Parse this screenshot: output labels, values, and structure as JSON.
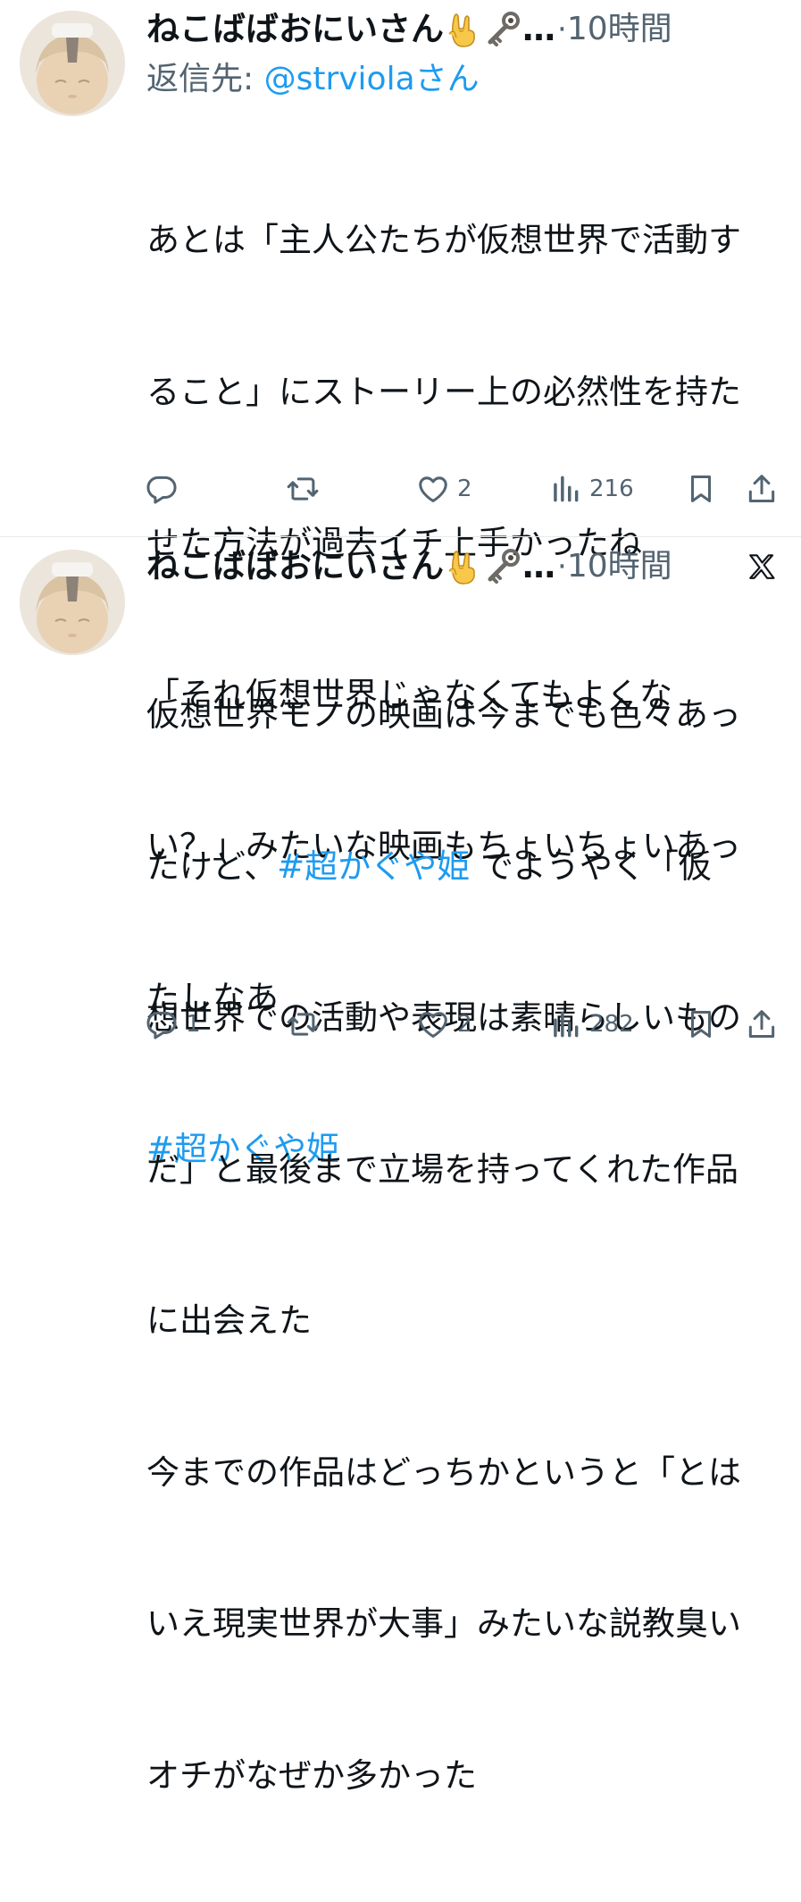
{
  "tweets": [
    {
      "author_name": "ねこばばおにいさん",
      "author_emojis": [
        "sign-of-the-horns-emoji",
        "old-key-emoji"
      ],
      "ellipsis": "…",
      "separator": "·",
      "time": "10時間",
      "reply_label": "返信先: ",
      "reply_handle": "@strviola",
      "reply_suffix": "さん",
      "lines": [
        {
          "pre": "あとは「主人公たちが仮想世界で活動す",
          "tag": "",
          "post": ""
        },
        {
          "pre": "ること」にストーリー上の必然性を持た",
          "tag": "",
          "post": ""
        },
        {
          "pre": "せた方法が過去イチ上手かったね",
          "tag": "",
          "post": ""
        },
        {
          "pre": "「それ仮想世界じゃなくてもよくな",
          "tag": "",
          "post": ""
        },
        {
          "pre": "い？」みたいな映画もちょいちょいあっ",
          "tag": "",
          "post": ""
        },
        {
          "pre": "たしなあ",
          "tag": "",
          "post": ""
        },
        {
          "pre": "",
          "tag": "#超かぐや姫",
          "post": ""
        }
      ],
      "actions": {
        "reply": "",
        "retweet": "",
        "like": "2",
        "views": "216"
      },
      "icons": [
        "reply-icon",
        "retweet-icon",
        "like-icon",
        "views-icon",
        "bookmark-icon",
        "share-icon"
      ]
    },
    {
      "author_name": "ねこばばおにいさん",
      "author_emojis": [
        "sign-of-the-horns-emoji",
        "old-key-emoji"
      ],
      "ellipsis": "…",
      "separator": "·",
      "time": "10時間",
      "platform_icon": "x-logo-icon",
      "lines": [
        {
          "pre": "仮想世界モノの映画は今までも色々あっ",
          "tag": "",
          "post": ""
        },
        {
          "pre": "たけど、",
          "tag": "#超かぐや姫",
          "post": "でようやく「仮"
        },
        {
          "pre": "想世界での活動や表現は素晴らしいもの",
          "tag": "",
          "post": ""
        },
        {
          "pre": "だ」と最後まで立場を持ってくれた作品",
          "tag": "",
          "post": ""
        },
        {
          "pre": "に出会えた",
          "tag": "",
          "post": ""
        },
        {
          "pre": "今までの作品はどっちかというと「とは",
          "tag": "",
          "post": ""
        },
        {
          "pre": "いえ現実世界が大事」みたいな説教臭い",
          "tag": "",
          "post": ""
        },
        {
          "pre": "オチがなぜか多かった",
          "tag": "",
          "post": ""
        }
      ],
      "actions": {
        "reply": "1",
        "retweet": "",
        "like": "2",
        "views": "282"
      },
      "icons": [
        "reply-icon",
        "retweet-icon",
        "like-icon",
        "views-icon",
        "bookmark-icon",
        "share-icon"
      ]
    }
  ],
  "colors": {
    "text": "#0f1419",
    "muted": "#536471",
    "link": "#1d9bf0",
    "divider": "#e7e9ea"
  }
}
